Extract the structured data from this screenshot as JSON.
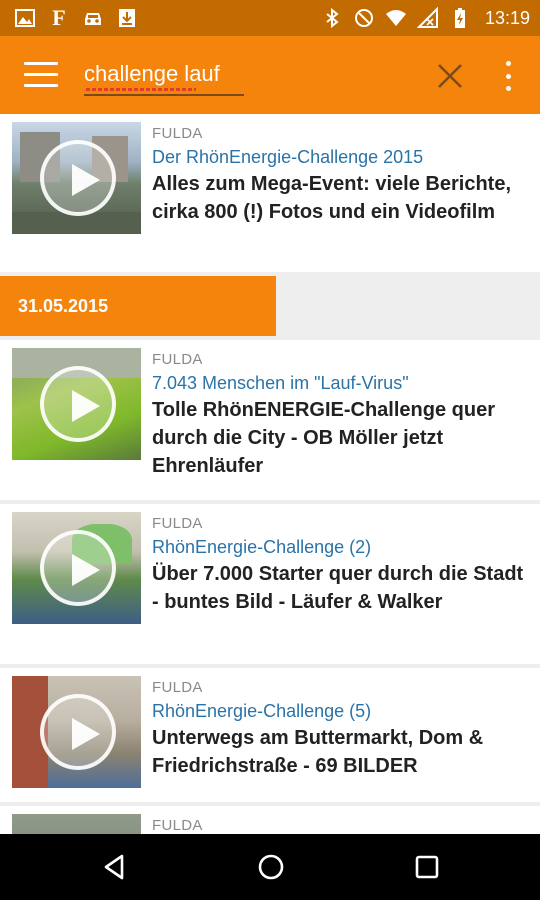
{
  "status_bar": {
    "time": "13:19",
    "left_icons": [
      "image-icon",
      "f-app-icon",
      "car-icon",
      "download-icon"
    ],
    "right_icons": [
      "bluetooth-icon",
      "do-not-disturb-icon",
      "wifi-icon",
      "no-signal-icon",
      "battery-charging-icon"
    ],
    "f_letter": "F"
  },
  "app_bar": {
    "search_value": "challenge lauf",
    "menu_icon": "hamburger-menu-icon",
    "clear_icon": "close-icon",
    "more_icon": "more-vert-icon"
  },
  "results": [
    {
      "location": "FULDA",
      "subtitle": "Der RhönEnergie-Challenge 2015",
      "headline": "Alles zum Mega-Event: viele Berichte, cirka 800 (!) Fotos und ein Videofilm"
    },
    {
      "location": "FULDA",
      "subtitle": "7.043 Menschen im \"Lauf-Virus\"",
      "headline": "Tolle RhönENERGIE-Challenge quer durch die City - OB Möller jetzt Ehrenläufer"
    },
    {
      "location": "FULDA",
      "subtitle": "RhönEnergie-Challenge (2)",
      "headline": "Über 7.000 Starter quer durch die Stadt - buntes Bild - Läufer & Walker"
    },
    {
      "location": "FULDA",
      "subtitle": "RhönEnergie-Challenge (5)",
      "headline": "Unterwegs am Buttermarkt, Dom & Friedrichstraße - 69 BILDER"
    },
    {
      "location": "FULDA",
      "subtitle": "",
      "headline": ""
    }
  ],
  "date_separator": "31.05.2015",
  "colors": {
    "accent": "#f5840c",
    "status_bar": "#c26b00",
    "link": "#2a73a8"
  },
  "nav_bar": {
    "icons": [
      "back-icon",
      "home-icon",
      "recent-apps-icon"
    ]
  }
}
